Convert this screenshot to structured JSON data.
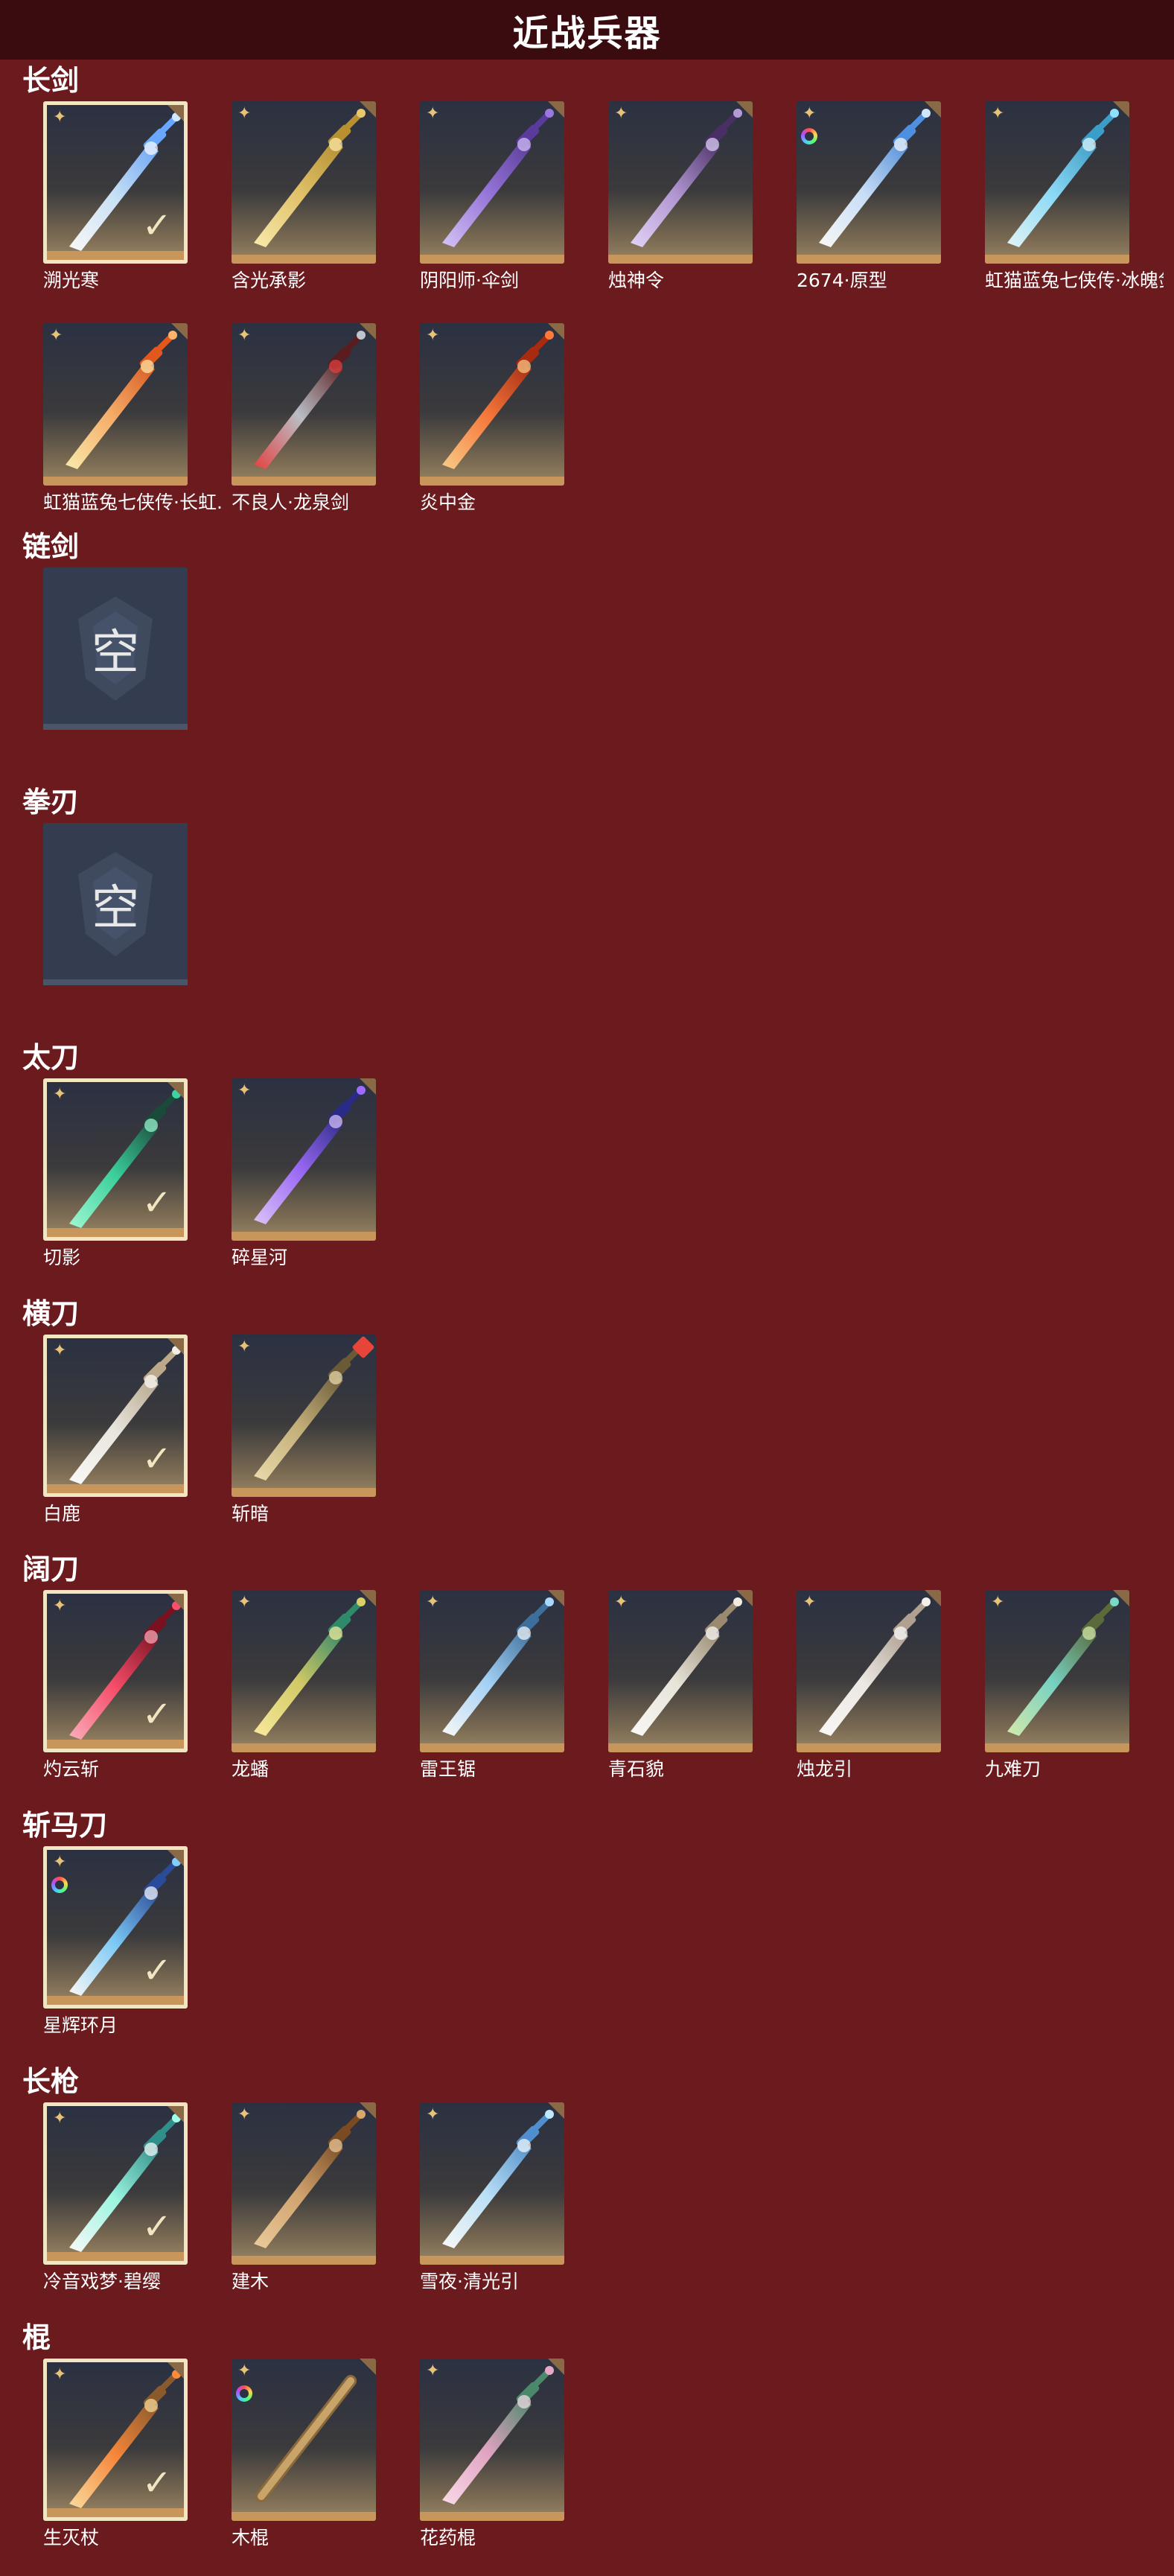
{
  "page": {
    "title": "近战兵器"
  },
  "colors": {
    "background": "#6b1a1e",
    "header": "#3a0c10",
    "tile_bar": "#c8955a",
    "selected_border": "#f2e6c2",
    "star": "#e7c27a"
  },
  "sections": [
    {
      "title": "长剑",
      "items": [
        {
          "name": "溯光寒",
          "selected": true,
          "star": true,
          "icon": "ice-crystal-sword-icon"
        },
        {
          "name": "含光承影",
          "selected": false,
          "star": true,
          "icon": "golden-sword-icon"
        },
        {
          "name": "阴阳师·伞剑",
          "selected": false,
          "star": true,
          "icon": "umbrella-sword-icon"
        },
        {
          "name": "烛神令",
          "selected": false,
          "star": true,
          "icon": "curved-dark-sword-icon"
        },
        {
          "name": "2674·原型",
          "selected": false,
          "star": true,
          "ring": true,
          "icon": "light-saber-sword-icon"
        },
        {
          "name": "虹猫蓝兔七侠传·冰魄剑",
          "selected": false,
          "star": true,
          "icon": "ice-blue-sword-icon"
        },
        {
          "name": "虹猫蓝兔七侠传·长虹剑",
          "display_name": "虹猫蓝兔七侠传·长虹..",
          "selected": false,
          "star": true,
          "icon": "flame-sword-icon"
        },
        {
          "name": "不良人·龙泉剑",
          "selected": false,
          "star": true,
          "icon": "dark-red-sword-icon"
        },
        {
          "name": "炎中金",
          "selected": false,
          "star": true,
          "icon": "fire-sword-icon"
        }
      ]
    },
    {
      "title": "链剑",
      "items": [
        {
          "name": "",
          "empty": true,
          "empty_label": "空"
        }
      ]
    },
    {
      "title": "拳刃",
      "items": [
        {
          "name": "",
          "empty": true,
          "empty_label": "空"
        }
      ]
    },
    {
      "title": "太刀",
      "items": [
        {
          "name": "切影",
          "selected": true,
          "star": true,
          "icon": "green-katana-icon"
        },
        {
          "name": "碎星河",
          "selected": false,
          "star": true,
          "icon": "purple-katana-icon"
        }
      ]
    },
    {
      "title": "横刀",
      "items": [
        {
          "name": "白鹿",
          "selected": true,
          "star": true,
          "icon": "white-deer-blade-icon"
        },
        {
          "name": "斩暗",
          "selected": false,
          "star": true,
          "gem": true,
          "icon": "bronze-blade-icon"
        }
      ]
    },
    {
      "title": "阔刀",
      "items": [
        {
          "name": "灼云斩",
          "selected": true,
          "star": true,
          "icon": "crimson-broadsword-icon"
        },
        {
          "name": "龙蟠",
          "selected": false,
          "star": true,
          "icon": "jade-broadsword-icon"
        },
        {
          "name": "雷王锯",
          "selected": false,
          "star": true,
          "icon": "thunder-broadsword-icon"
        },
        {
          "name": "青石貌",
          "selected": false,
          "star": true,
          "icon": "white-dragon-broadsword-icon"
        },
        {
          "name": "烛龙引",
          "selected": false,
          "star": true,
          "icon": "pale-broadsword-icon"
        },
        {
          "name": "九难刀",
          "selected": false,
          "star": true,
          "icon": "teal-broadsword-icon"
        }
      ]
    },
    {
      "title": "斩马刀",
      "items": [
        {
          "name": "星辉环月",
          "selected": true,
          "star": true,
          "ring": true,
          "icon": "moon-ring-blade-icon"
        }
      ]
    },
    {
      "title": "长枪",
      "items": [
        {
          "name": "冷音戏梦·碧缨",
          "selected": true,
          "star": true,
          "icon": "jade-spear-icon"
        },
        {
          "name": "建木",
          "selected": false,
          "star": true,
          "icon": "wood-spear-icon"
        },
        {
          "name": "雪夜·清光引",
          "selected": false,
          "star": true,
          "icon": "ice-spear-icon"
        }
      ]
    },
    {
      "title": "棍",
      "items": [
        {
          "name": "生灭杖",
          "selected": true,
          "star": true,
          "icon": "flame-staff-icon"
        },
        {
          "name": "木棍",
          "selected": false,
          "star": true,
          "ring": true,
          "icon": "wooden-staff-icon"
        },
        {
          "name": "花药棍",
          "selected": false,
          "star": true,
          "icon": "flower-staff-icon"
        }
      ]
    }
  ]
}
